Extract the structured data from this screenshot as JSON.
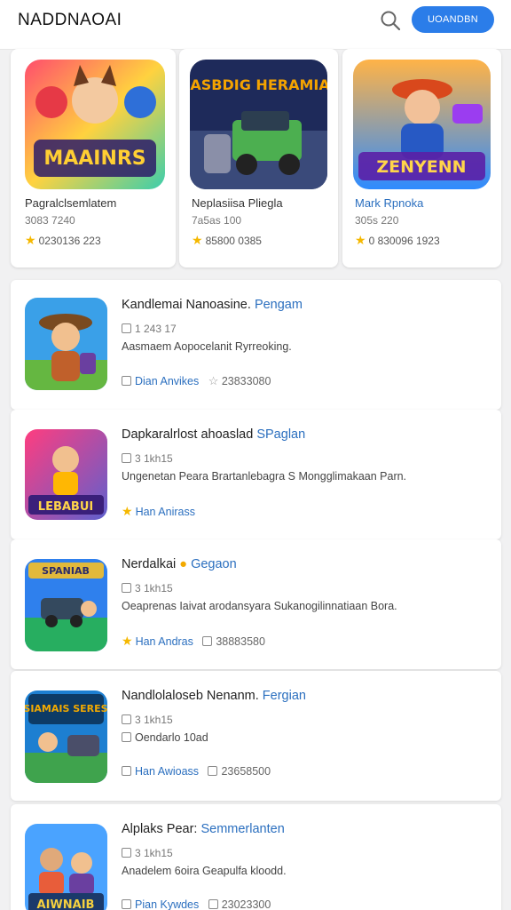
{
  "header": {
    "app_title": "NADDNAOAI",
    "cta_label": "UOANDBN"
  },
  "featured": [
    {
      "name": "Pagralclsemlatem",
      "meta": "3083 7240",
      "rating": "0230136 223",
      "colors": [
        "#ff4d6d",
        "#ffd23f",
        "#3bceac"
      ]
    },
    {
      "name": "Neplasiisa Pliegla",
      "meta": "7a5as 100",
      "rating": "85800 0385",
      "colors": [
        "#1e2a5a",
        "#f4a300",
        "#4caf50"
      ]
    },
    {
      "name": "Mark Rpnoka",
      "meta": "305s 220",
      "rating": "0 830096 1923",
      "colors": [
        "#ff7a1a",
        "#2e8bff",
        "#9b3df0"
      ]
    }
  ],
  "featured_art_text": [
    "MAAINRS",
    "SIASBDIG HERAMIAN",
    "ZENYENN"
  ],
  "list": [
    {
      "title": "Kandlemai Nanoasine.",
      "tag": "Pengam",
      "sub": "1 243 17",
      "desc": "Aasmaem Aopocelanit Ryrreoking.",
      "foot_left": "Dian Anvikes",
      "foot_right": "23833080",
      "colors": [
        "#3aa0e8",
        "#7a4a1f",
        "#65b741"
      ]
    },
    {
      "title": "Dapkaralrlost ahoaslad",
      "tag": "SPaglan",
      "sub": "3 1kh15",
      "desc": "Ungenetan Peara Brartanlebagra S Mongglimakaan Parn.",
      "foot_left": "Han Anirass",
      "foot_right": "",
      "colors": [
        "#ff3d7f",
        "#ffb703",
        "#5e60ce"
      ]
    },
    {
      "title": "Nerdalkai",
      "tag": "Gegaon",
      "sub": "3 1kh15",
      "desc": "Oeaprenas Iaivat arodansyara Sukanogilinnatiaan Bora.",
      "foot_left": "Han Andras",
      "foot_right": "38883580",
      "colors": [
        "#2f80ed",
        "#27ae60",
        "#e2b93b"
      ]
    },
    {
      "title": "Nandlolaloseb Nenanm.",
      "tag": "Fergian",
      "sub": "3 1kh15",
      "desc": "Oendarlo 10ad",
      "foot_left": "Han Awioass",
      "foot_right": "23658500",
      "colors": [
        "#1d7fd1",
        "#f2a900",
        "#3fa34d"
      ]
    },
    {
      "title": "Alplaks Pear:",
      "tag": "Semmerlanten",
      "sub": "3 1kh15",
      "desc": "Anadelem 6oira Geapulfa kloodd.",
      "foot_left": "Pian Kywdes",
      "foot_right": "23023300",
      "colors": [
        "#4aa3ff",
        "#e85d3a",
        "#f4d03f"
      ]
    }
  ],
  "list_art_text": [
    "",
    "LEBABUI",
    "SPANIAB",
    "SIAMAIS SERES",
    "AIWNAIB"
  ],
  "accent_color": "#2b7de9",
  "star_color": "#f5b800"
}
